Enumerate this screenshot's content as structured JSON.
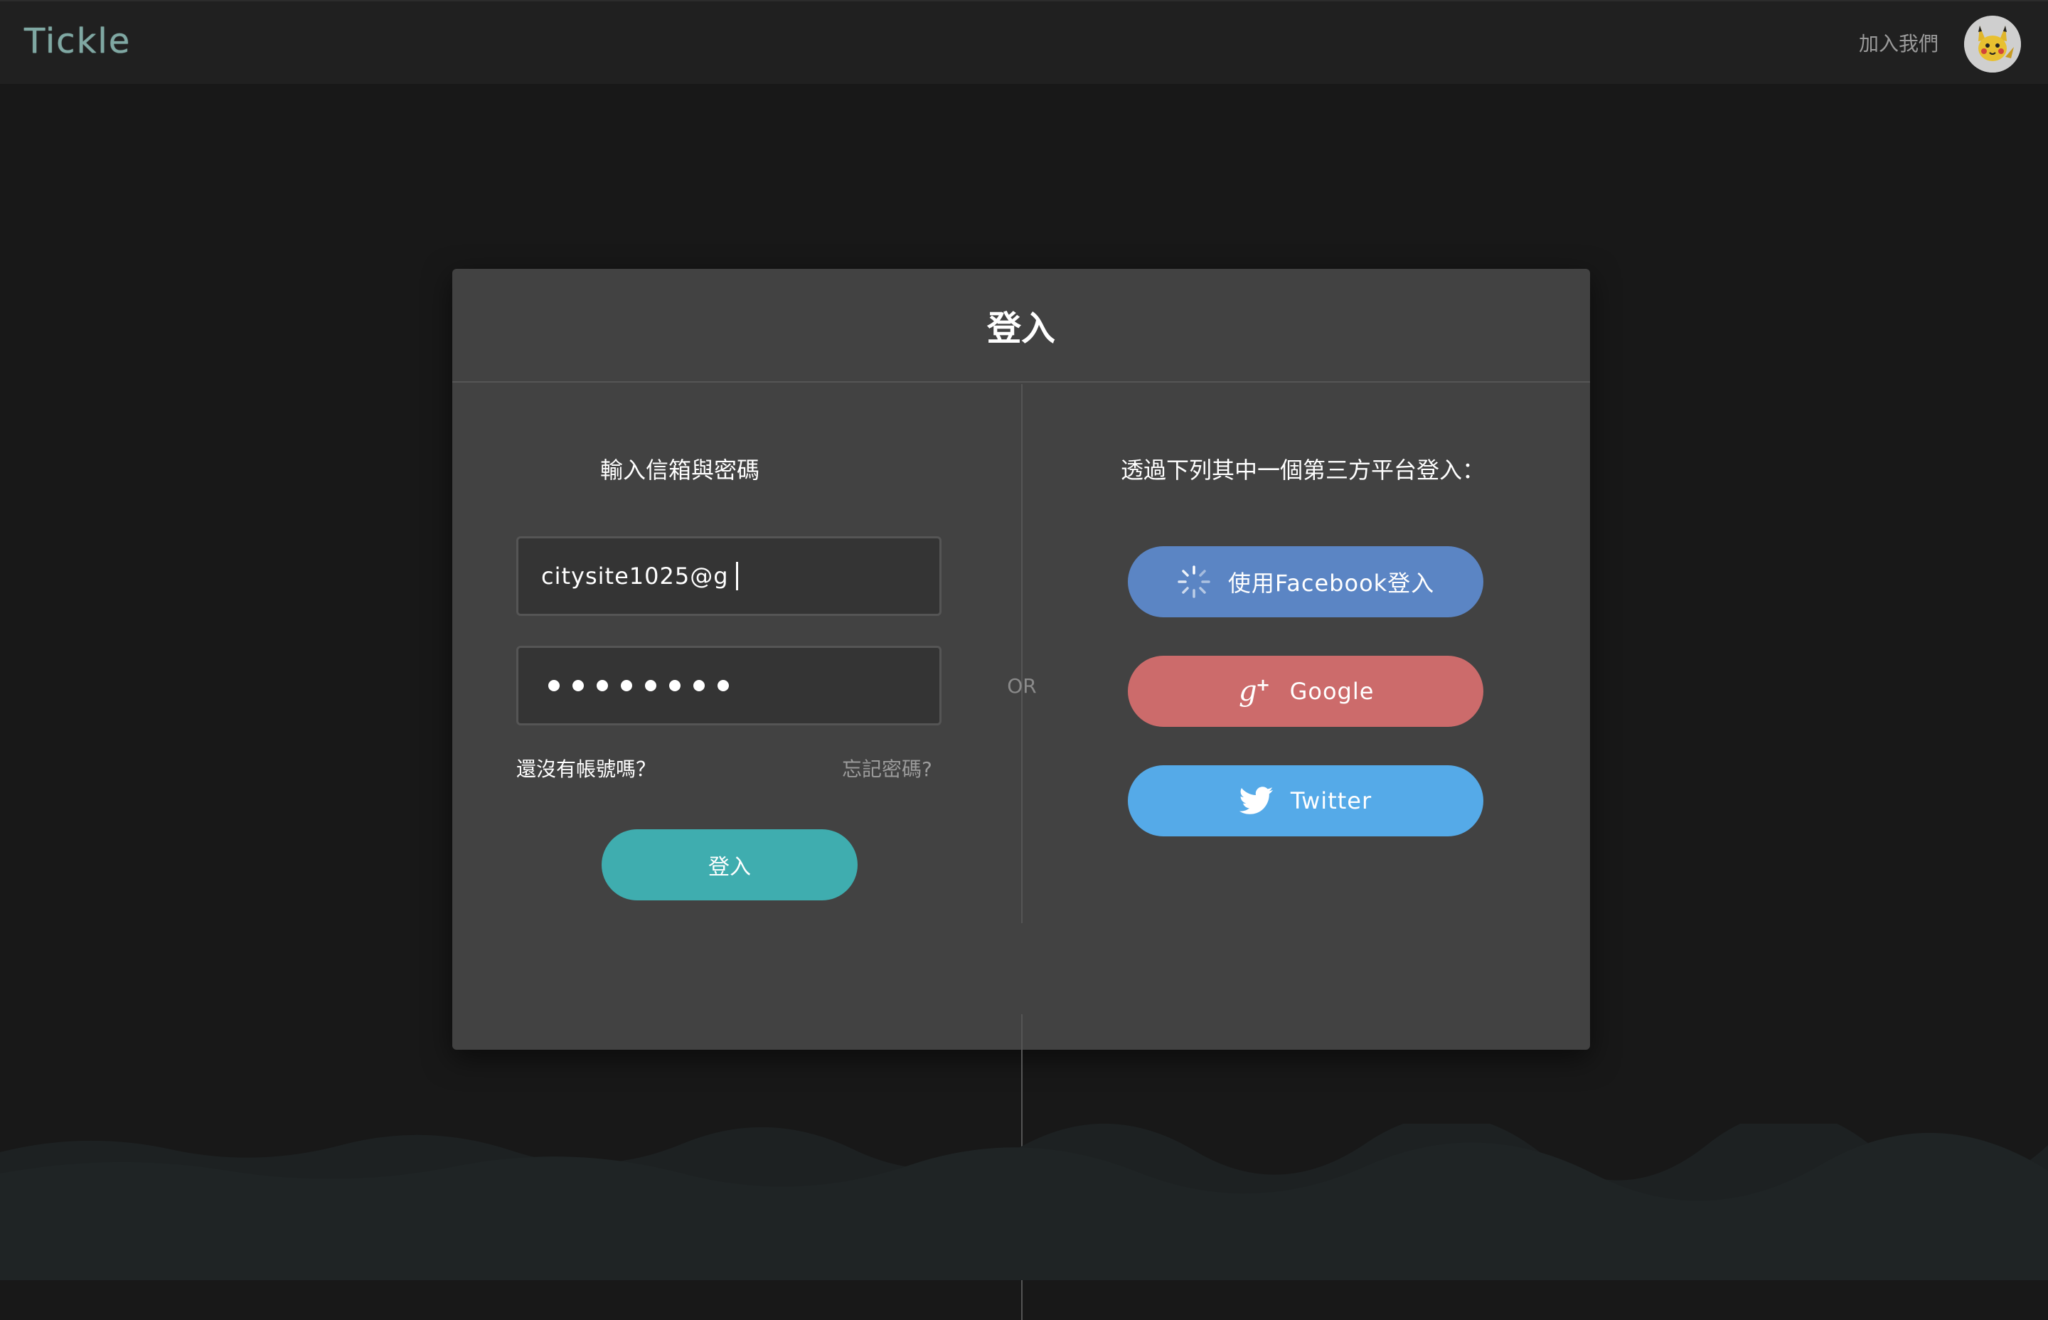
{
  "header": {
    "logo": "Tickle",
    "join_label": "加入我們"
  },
  "modal": {
    "title": "登入",
    "or_label": "OR",
    "left": {
      "title": "輸入信箱與密碼",
      "email_value": "citysite1025@g",
      "password_masked": "••••••••",
      "signup_link": "還沒有帳號嗎？",
      "forgot_link": "忘記密碼?",
      "login_button": "登入"
    },
    "right": {
      "title": "透過下列其中一個第三方平台登入：",
      "facebook_button": "使用Facebook登入",
      "google_button": "Google",
      "twitter_button": "Twitter"
    }
  },
  "colors": {
    "background": "#181818",
    "modal": "#424242",
    "accent_teal": "#3fadaf",
    "facebook": "#5b85c4",
    "google": "#cc6b6b",
    "twitter": "#55aae8"
  },
  "icons": [
    "user-avatar",
    "loading-spinner-icon",
    "google-plus-icon",
    "twitter-bird-icon"
  ]
}
